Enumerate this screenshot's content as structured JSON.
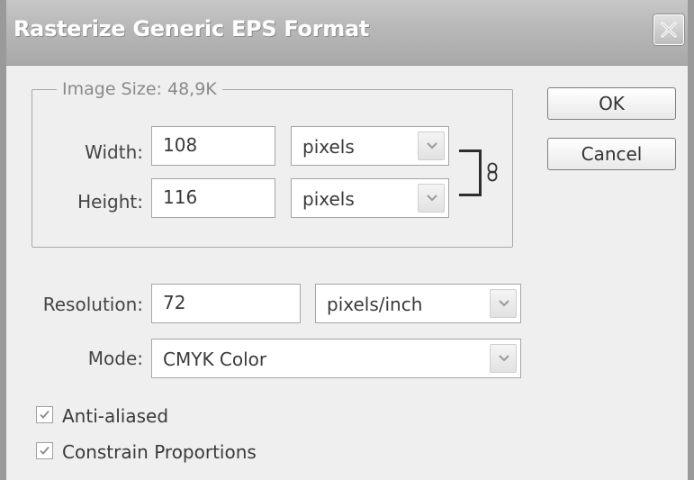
{
  "window": {
    "title": "Rasterize Generic EPS Format"
  },
  "image_size": {
    "legend": "Image Size: 48,9K",
    "width": {
      "label": "Width:",
      "value": "108",
      "unit": "pixels"
    },
    "height": {
      "label": "Height:",
      "value": "116",
      "unit": "pixels"
    }
  },
  "resolution": {
    "label": "Resolution:",
    "value": "72",
    "unit": "pixels/inch"
  },
  "mode": {
    "label": "Mode:",
    "value": "CMYK Color"
  },
  "options": {
    "anti_aliased": {
      "label": "Anti-aliased",
      "checked": true
    },
    "constrain_proportions": {
      "label": "Constrain Proportions",
      "checked": true
    }
  },
  "buttons": {
    "ok": "OK",
    "cancel": "Cancel"
  },
  "icons": {
    "close": "close-icon",
    "dropdown": "chevron-down-icon",
    "checkbox": "checkmark-icon",
    "link": "chain-link-icon"
  }
}
